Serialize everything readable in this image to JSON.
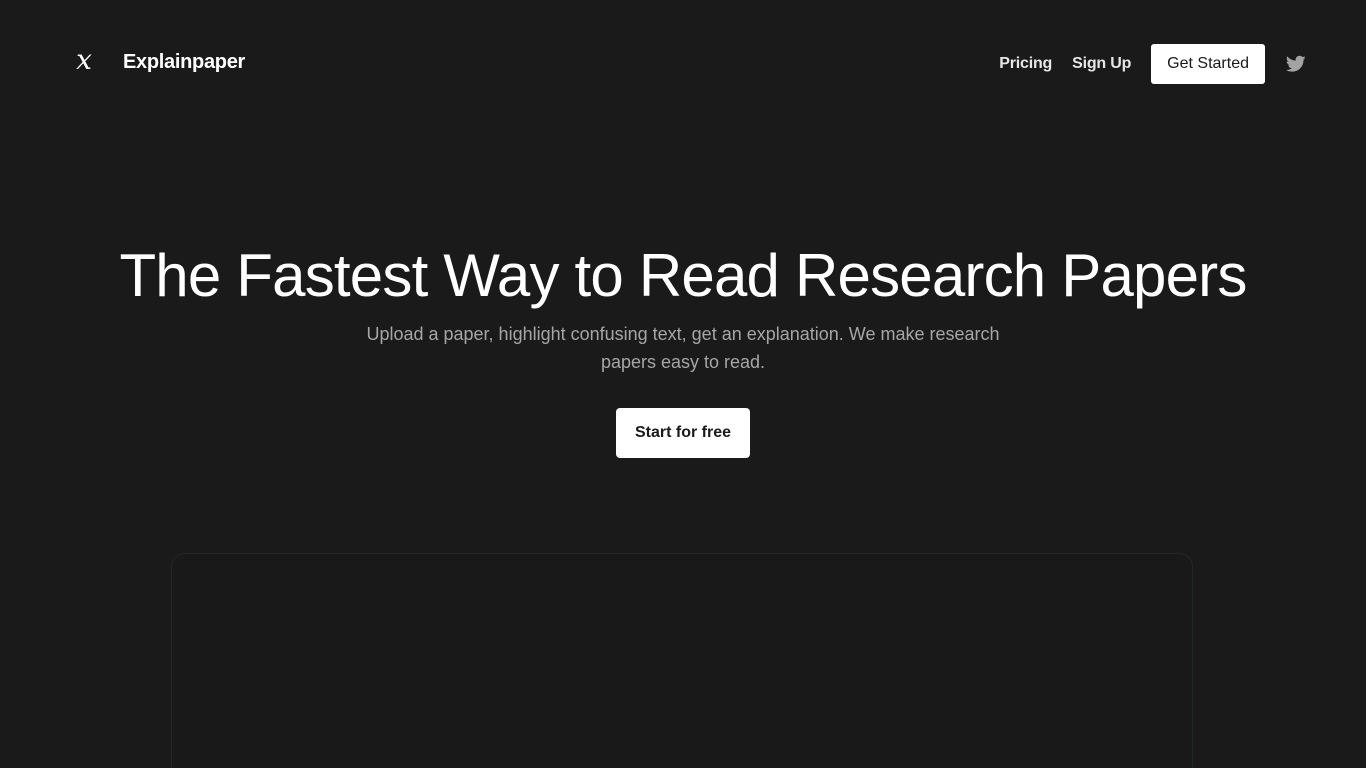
{
  "header": {
    "logo_mark": "x",
    "brand": "Explainpaper",
    "nav": {
      "pricing": "Pricing",
      "sign_up": "Sign Up",
      "get_started": "Get Started"
    },
    "social_icon": "twitter-icon"
  },
  "hero": {
    "title": "The Fastest Way to Read Research Papers",
    "subtitle": "Upload a paper, highlight confusing text, get an explanation. We make research papers easy to read.",
    "cta": "Start for free"
  },
  "colors": {
    "background": "#1a1a1a",
    "text": "#ffffff",
    "muted_text": "#a6a6a6",
    "button_bg": "#ffffff",
    "button_text": "#1a1a1a",
    "preview_border": "#232a26"
  }
}
